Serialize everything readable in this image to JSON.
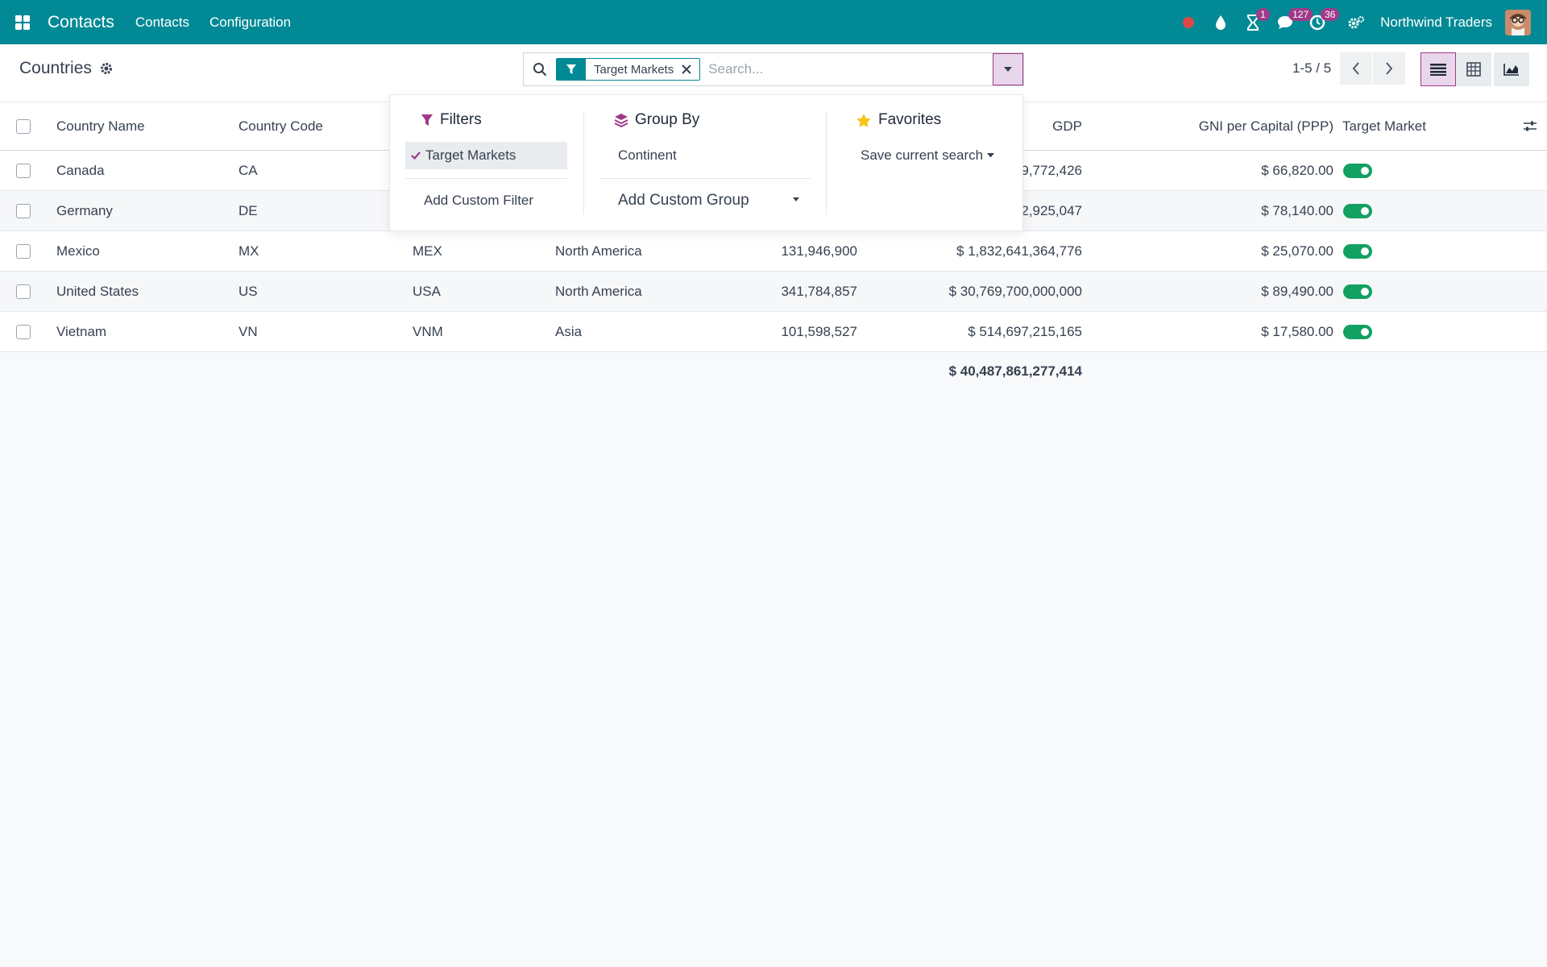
{
  "navbar": {
    "app_name": "Contacts",
    "menus": [
      "Contacts",
      "Configuration"
    ],
    "badges": {
      "activity": "1",
      "messages": "127",
      "timer": "36"
    },
    "company": "Northwind Traders"
  },
  "control": {
    "breadcrumb": "Countries",
    "facet": "Target Markets",
    "search_placeholder": "Search...",
    "pager": "1-5 / 5"
  },
  "dropdown": {
    "filters": {
      "title": "Filters",
      "items": [
        "Target Markets"
      ],
      "add": "Add Custom Filter"
    },
    "groupby": {
      "title": "Group By",
      "items": [
        "Continent"
      ],
      "add": "Add Custom Group"
    },
    "favorites": {
      "title": "Favorites",
      "save": "Save current search"
    }
  },
  "table": {
    "headers": [
      "Country Name",
      "Country Code",
      "GDP",
      "GNI per Capital (PPP)",
      "Target Market"
    ],
    "rows": [
      {
        "name": "Canada",
        "code": "CA",
        "iso3": "",
        "continent": "",
        "population": "",
        "gdp": "9,772,426",
        "gni": "$ 66,820.00"
      },
      {
        "name": "Germany",
        "code": "DE",
        "iso3": "",
        "continent": "",
        "population": "",
        "gdp": "2,925,047",
        "gni": "$ 78,140.00"
      },
      {
        "name": "Mexico",
        "code": "MX",
        "iso3": "MEX",
        "continent": "North America",
        "population": "131,946,900",
        "gdp": "$ 1,832,641,364,776",
        "gni": "$ 25,070.00"
      },
      {
        "name": "United States",
        "code": "US",
        "iso3": "USA",
        "continent": "North America",
        "population": "341,784,857",
        "gdp": "$ 30,769,700,000,000",
        "gni": "$ 89,490.00"
      },
      {
        "name": "Vietnam",
        "code": "VN",
        "iso3": "VNM",
        "continent": "Asia",
        "population": "101,598,527",
        "gdp": "$ 514,697,215,165",
        "gni": "$ 17,580.00"
      }
    ],
    "total_gdp": "$ 40,487,861,277,414"
  },
  "colors": {
    "navbar": "#018a96",
    "accent": "#9e3a8a",
    "toggle_on": "#12a162"
  }
}
